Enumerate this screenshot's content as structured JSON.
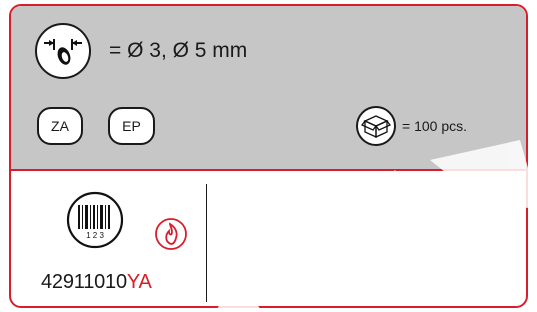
{
  "header": {
    "drill_icon": "drill-bit-diameter-icon",
    "diameter_text": "= Ø 3, Ø 5 mm"
  },
  "tags": [
    {
      "label": "ZA"
    },
    {
      "label": "EP"
    }
  ],
  "package": {
    "box_icon": "box-icon",
    "quantity_text": "= 100 pcs."
  },
  "product": {
    "barcode_icon": "barcode-icon",
    "barcode_digits": "1 2 3",
    "flame_icon": "flame-icon",
    "article_number": "42911010",
    "article_suffix": "YA"
  },
  "colors": {
    "accent": "#d81e2c",
    "panel": "#c6c6c6",
    "ink": "#1a1a1a"
  }
}
